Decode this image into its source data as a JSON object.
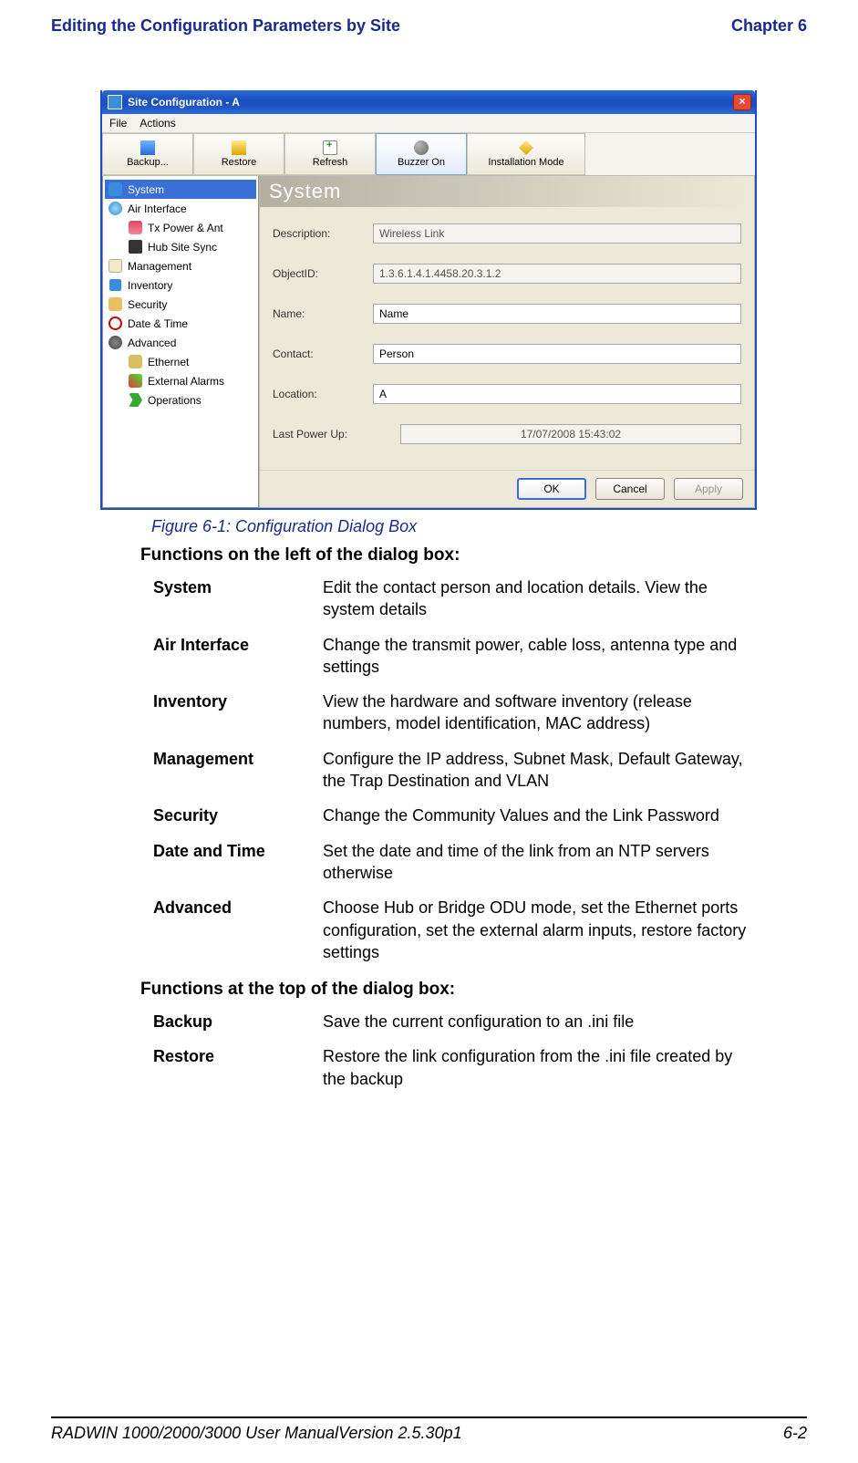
{
  "header": {
    "left": "Editing the Configuration Parameters by Site",
    "right": "Chapter 6"
  },
  "window": {
    "title": "Site Configuration - A",
    "menu": [
      "File",
      "Actions"
    ],
    "toolbar": {
      "backup": "Backup...",
      "restore": "Restore",
      "refresh": "Refresh",
      "buzzer": "Buzzer On",
      "install": "Installation Mode"
    },
    "tree": {
      "system": "System",
      "air": "Air Interface",
      "tx": "Tx Power & Ant",
      "hub": "Hub Site Sync",
      "mgmt": "Management",
      "inv": "Inventory",
      "sec": "Security",
      "dt": "Date & Time",
      "adv": "Advanced",
      "eth": "Ethernet",
      "alm": "External Alarms",
      "ops": "Operations"
    },
    "pane": {
      "title": "System",
      "fields": {
        "desc_l": "Description:",
        "desc_v": "Wireless Link",
        "oid_l": "ObjectID:",
        "oid_v": "1.3.6.1.4.1.4458.20.3.1.2",
        "name_l": "Name:",
        "name_v": "Name",
        "contact_l": "Contact:",
        "contact_v": "Person",
        "loc_l": "Location:",
        "loc_v": "A",
        "lpu_l": "Last Power Up:",
        "lpu_v": "17/07/2008 15:43:02"
      },
      "buttons": {
        "ok": "OK",
        "cancel": "Cancel",
        "apply": "Apply"
      }
    }
  },
  "caption": "Figure 6-1: Configuration Dialog Box",
  "sub1": "Functions on the left of the dialog box:",
  "left_funcs": [
    {
      "k": "System",
      "d": "Edit the contact person and location details. View the system details"
    },
    {
      "k": "Air Interface",
      "d": "Change the transmit power, cable loss, antenna type and settings"
    },
    {
      "k": "Inventory",
      "d": "View the hardware and software inventory (release numbers, model identification, MAC address)"
    },
    {
      "k": "Management",
      "d": "Configure the IP address, Subnet Mask, Default Gateway, the Trap Destination and VLAN"
    },
    {
      "k": "Security",
      "d": "Change the Community Values and the Link Password"
    },
    {
      "k": "Date and Time",
      "d": "Set the date and time of the link from an NTP servers otherwise"
    },
    {
      "k": "Advanced",
      "d": "Choose Hub or Bridge ODU mode, set the Ethernet ports configuration, set the external alarm inputs, restore factory settings"
    }
  ],
  "sub2": "Functions at the top of the dialog box:",
  "top_funcs": [
    {
      "k": "Backup",
      "d": "Save the current configuration to an .ini file"
    },
    {
      "k": "Restore",
      "d": "Restore the link configuration from the .ini file created by the backup"
    }
  ],
  "footer": {
    "left": "RADWIN 1000/2000/3000 User ManualVersion  2.5.30p1",
    "right": "6-2"
  }
}
